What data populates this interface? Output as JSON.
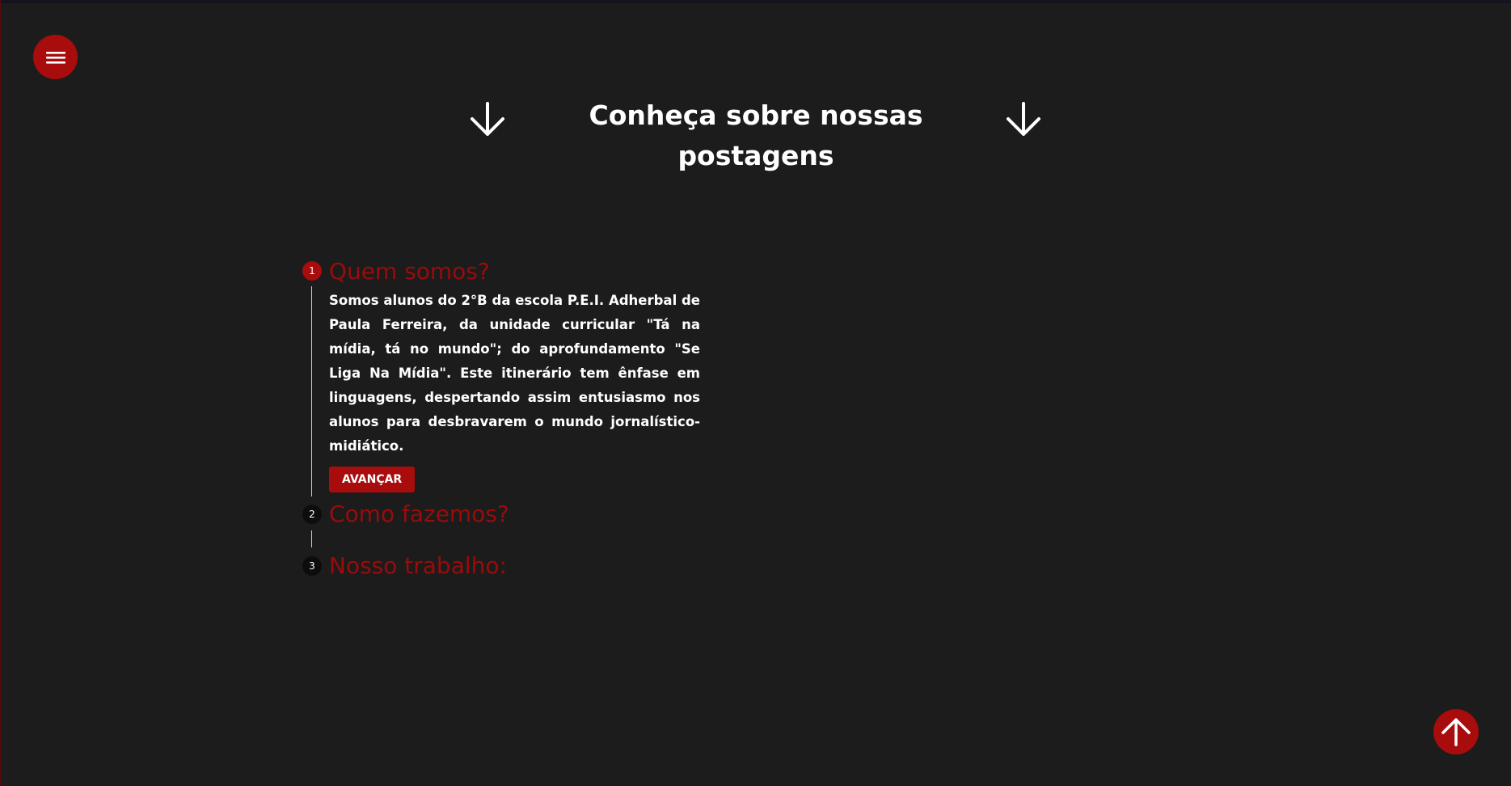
{
  "header": {
    "title": "Conheça sobre nossas postagens"
  },
  "nav": {
    "menu_icon": "hamburger-menu-icon",
    "scroll_top_icon": "arrow-up-icon"
  },
  "colors": {
    "background": "#1c1c1c",
    "accent": "#a90c0c",
    "step_title": "#9a0b0b",
    "text": "#ffffff"
  },
  "steps": [
    {
      "number": "1",
      "title": "Quem somos?",
      "body": "Somos alunos do 2°B da escola P.E.I. Adherbal de Paula Ferreira, da unidade curricular \"Tá na mídia, tá no mundo\"; do aprofundamento \"Se Liga Na Mídia\". Este itinerário tem ênfase em linguagens, despertando assim entusiasmo nos alunos para desbravarem o mundo jornalístico-midiático.",
      "button_label": "AVANÇAR",
      "active": true
    },
    {
      "number": "2",
      "title": "Como fazemos?",
      "active": false
    },
    {
      "number": "3",
      "title": "Nosso trabalho:",
      "active": false
    }
  ]
}
